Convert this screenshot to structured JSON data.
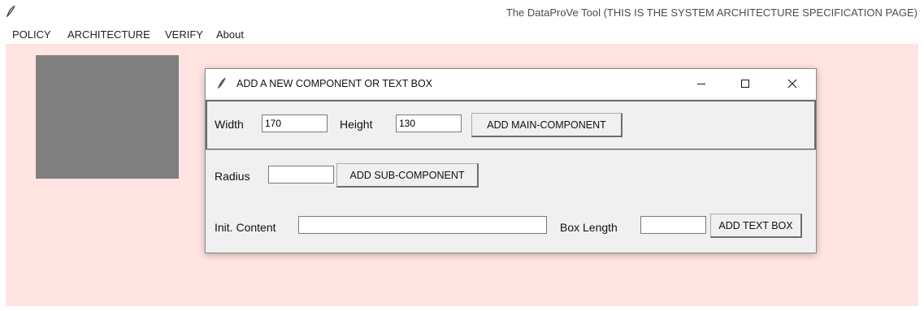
{
  "app": {
    "title": "The DataProVe Tool (THIS IS THE SYSTEM ARCHITECTURE SPECIFICATION PAGE)",
    "icon": "feather-icon"
  },
  "menubar": {
    "items": [
      {
        "label": "POLICY"
      },
      {
        "label": "ARCHITECTURE"
      },
      {
        "label": "VERIFY"
      },
      {
        "label": "About"
      }
    ]
  },
  "canvas": {
    "background_color": "#ffe4e1",
    "component_color": "#808080"
  },
  "dialog": {
    "title": "ADD A NEW COMPONENT OR TEXT BOX",
    "controls": {
      "minimize": "minimize-icon",
      "maximize": "maximize-icon",
      "close": "close-icon"
    },
    "main_component": {
      "width_label": "Width",
      "width_value": "170",
      "height_label": "Height",
      "height_value": "130",
      "button_label": "ADD MAIN-COMPONENT"
    },
    "sub_component": {
      "radius_label": "Radius",
      "radius_value": "",
      "button_label": "ADD SUB-COMPONENT"
    },
    "text_box": {
      "content_label": "Init. Content",
      "content_value": "",
      "length_label": "Box Length",
      "length_value": "",
      "button_label": "ADD TEXT BOX"
    }
  }
}
